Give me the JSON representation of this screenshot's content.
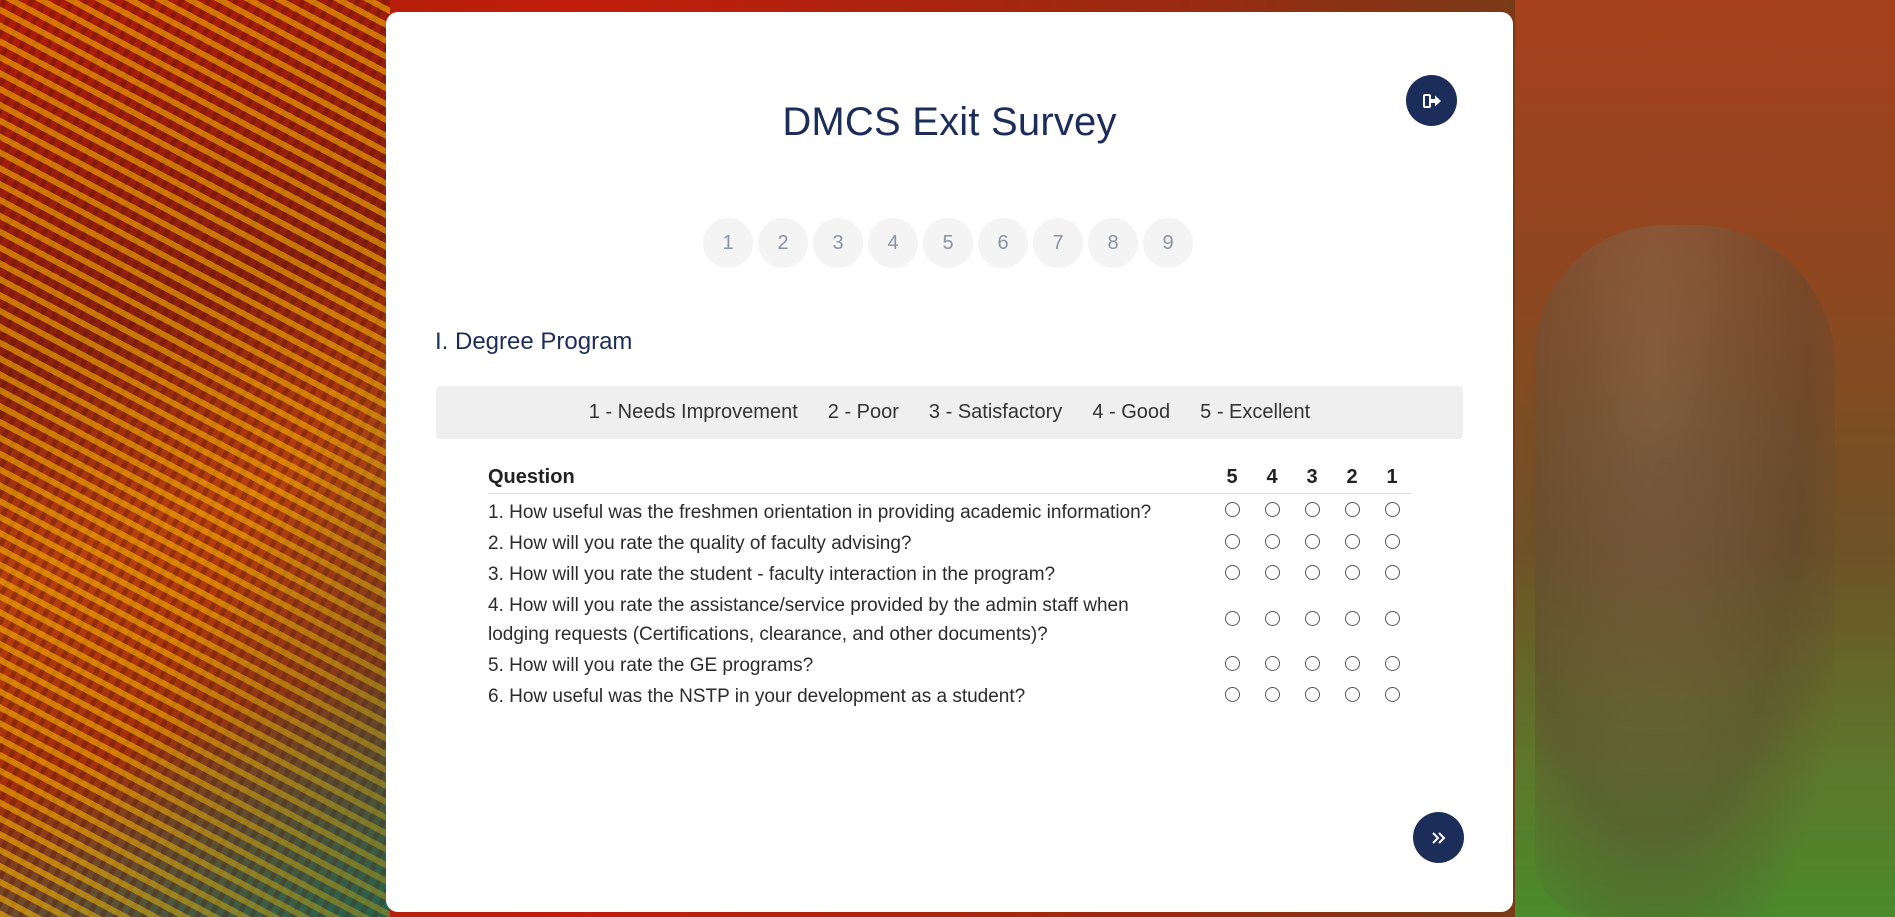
{
  "header": {
    "title": "DMCS Exit Survey",
    "logout_icon": "logout-icon"
  },
  "steps": [
    "1",
    "2",
    "3",
    "4",
    "5",
    "6",
    "7",
    "8",
    "9"
  ],
  "section": {
    "title": "I. Degree Program"
  },
  "scale": [
    "1 - Needs Improvement",
    "2 - Poor",
    "3 - Satisfactory",
    "4 - Good",
    "5 - Excellent"
  ],
  "table": {
    "question_header": "Question",
    "rating_headers": [
      "5",
      "4",
      "3",
      "2",
      "1"
    ],
    "questions": [
      "1. How useful was the freshmen orientation in providing academic information?",
      "2. How will you rate the quality of faculty advising?",
      "3. How will you rate the student - faculty interaction in the program?",
      "4. How will you rate the assistance/service provided by the admin staff when lodging requests (Certifications, clearance, and other documents)?",
      "5. How will you rate the GE programs?",
      "6. How useful was the NSTP in your development as a student?"
    ]
  },
  "nav": {
    "next_icon": "double-chevron-right-icon"
  },
  "colors": {
    "primary": "#1d2d5a",
    "step_bg": "#f4f4f4",
    "scale_bg": "#efefef"
  }
}
